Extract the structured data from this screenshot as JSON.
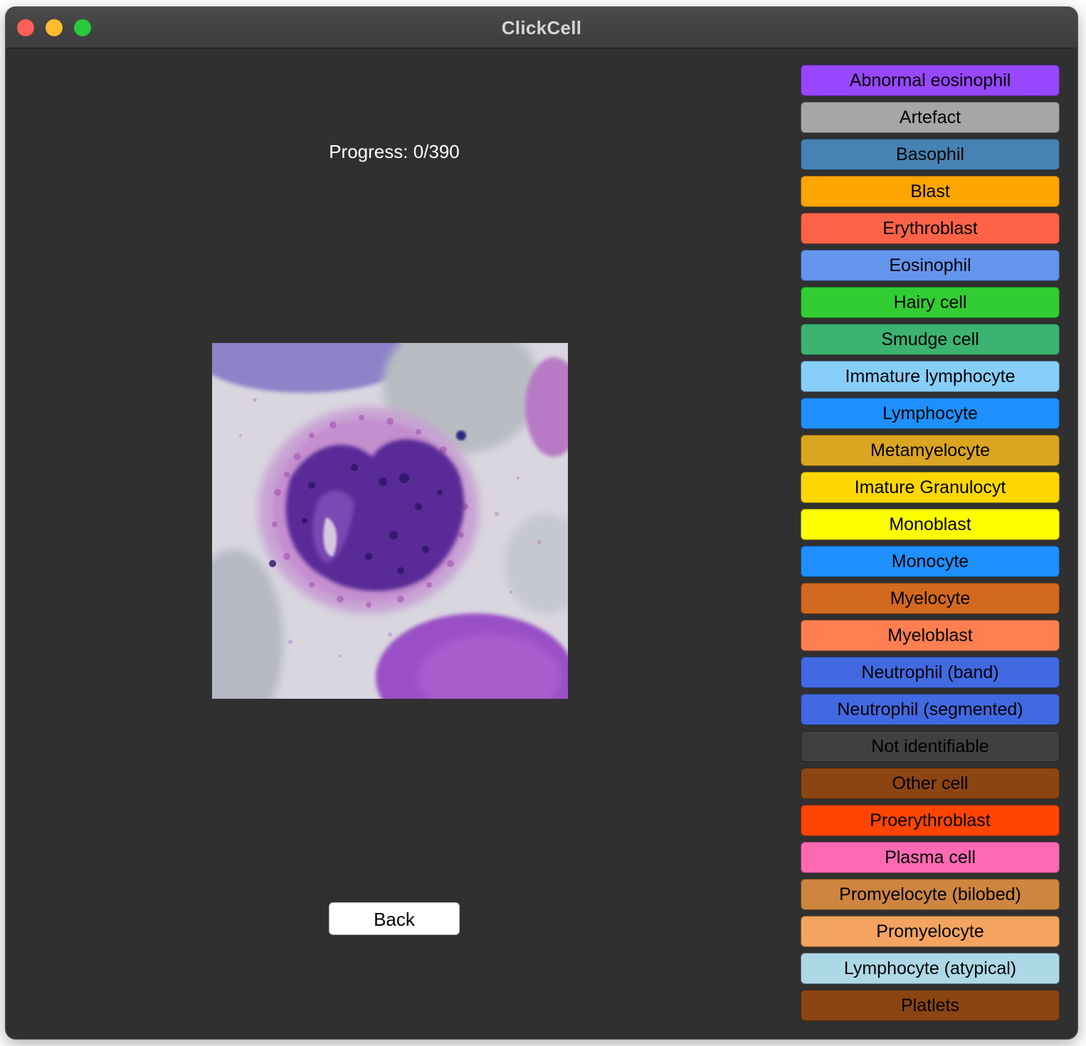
{
  "window": {
    "title": "ClickCell"
  },
  "main": {
    "progress_text": "Progress: 0/390",
    "back_label": "Back"
  },
  "categories": [
    {
      "label": "Abnormal eosinophil",
      "color": "#9747ff"
    },
    {
      "label": "Artefact",
      "color": "#a6a6a6"
    },
    {
      "label": "Basophil",
      "color": "#4682b4"
    },
    {
      "label": "Blast",
      "color": "#ffa500"
    },
    {
      "label": "Erythroblast",
      "color": "#ff6347"
    },
    {
      "label": "Eosinophil",
      "color": "#6495ed"
    },
    {
      "label": "Hairy cell",
      "color": "#32cd32"
    },
    {
      "label": "Smudge cell",
      "color": "#3cb371"
    },
    {
      "label": "Immature lymphocyte",
      "color": "#87cefa"
    },
    {
      "label": "Lymphocyte",
      "color": "#1e90ff"
    },
    {
      "label": "Metamyelocyte",
      "color": "#daa520"
    },
    {
      "label": "Imature Granulocyt",
      "color": "#ffd700"
    },
    {
      "label": "Monoblast",
      "color": "#ffff00"
    },
    {
      "label": "Monocyte",
      "color": "#1e90ff"
    },
    {
      "label": "Myelocyte",
      "color": "#d2691e"
    },
    {
      "label": "Myeloblast",
      "color": "#ff7f50"
    },
    {
      "label": "Neutrophil (band)",
      "color": "#4169e1"
    },
    {
      "label": "Neutrophil (segmented)",
      "color": "#4169e1"
    },
    {
      "label": "Not identifiable",
      "color": "#404040"
    },
    {
      "label": "Other cell",
      "color": "#8b4513"
    },
    {
      "label": "Proerythroblast",
      "color": "#ff4500"
    },
    {
      "label": "Plasma cell",
      "color": "#ff69b4"
    },
    {
      "label": "Promyelocyte (bilobed)",
      "color": "#cd853f"
    },
    {
      "label": "Promyelocyte",
      "color": "#f4a460"
    },
    {
      "label": "Lymphocyte (atypical)",
      "color": "#add8e6"
    },
    {
      "label": "Platlets",
      "color": "#8b4513"
    }
  ]
}
